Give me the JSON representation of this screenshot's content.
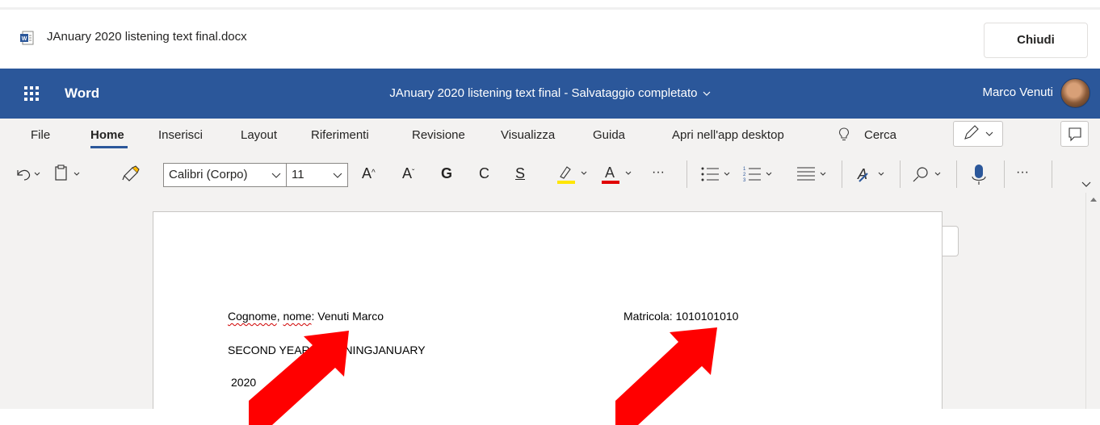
{
  "file_header": {
    "file_name": "JAnuary 2020 listening text final.docx",
    "close_label": "Chiudi"
  },
  "titlebar": {
    "app_name": "Word",
    "doc_title": "JAnuary 2020 listening text final",
    "separator": "-",
    "save_status": "Salvataggio completato",
    "user_name": "Marco Venuti"
  },
  "ribbon": {
    "tabs": [
      "File",
      "Home",
      "Inserisci",
      "Layout",
      "Riferimenti",
      "Revisione",
      "Visualizza",
      "Guida",
      "Apri nell'app desktop"
    ],
    "active_tab": "Home",
    "search_label": "Cerca"
  },
  "toolbar": {
    "font_name": "Calibri (Corpo)",
    "font_size": "11",
    "bold_label": "G",
    "italic_label": "C",
    "underline_label": "S",
    "highlight_color": "#ffe600",
    "font_color": "#e00000",
    "more_label": "···"
  },
  "document": {
    "line1_label": "Cognome, nome:",
    "line1_squiggle_1": "Cognome",
    "line1_squiggle_2": "nome",
    "line1_value": "Venuti Marco",
    "matricola": "Matricola: 1010101010",
    "line2": "SECOND YEAR LISTENINGJANUARY",
    "line2_visible_left": "SECOND YEAR",
    "line2_visible_right": "NINGJANUARY",
    "line3": "2020"
  },
  "colors": {
    "word_blue": "#2b579a",
    "arrow_red": "#ff0000"
  }
}
